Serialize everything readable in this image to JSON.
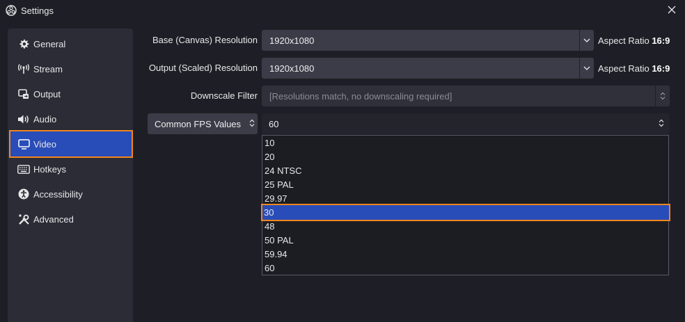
{
  "window": {
    "title": "Settings"
  },
  "sidebar": {
    "items": [
      {
        "label": "General",
        "icon": "gear-icon"
      },
      {
        "label": "Stream",
        "icon": "antenna-icon"
      },
      {
        "label": "Output",
        "icon": "output-icon"
      },
      {
        "label": "Audio",
        "icon": "speaker-icon"
      },
      {
        "label": "Video",
        "icon": "monitor-icon",
        "active": true
      },
      {
        "label": "Hotkeys",
        "icon": "keyboard-icon"
      },
      {
        "label": "Accessibility",
        "icon": "accessibility-icon"
      },
      {
        "label": "Advanced",
        "icon": "tools-icon"
      }
    ]
  },
  "video": {
    "base_resolution": {
      "label": "Base (Canvas) Resolution",
      "value": "1920x1080",
      "aspect_prefix": "Aspect Ratio",
      "aspect_value": "16:9"
    },
    "output_resolution": {
      "label": "Output (Scaled) Resolution",
      "value": "1920x1080",
      "aspect_prefix": "Aspect Ratio",
      "aspect_value": "16:9"
    },
    "downscale_filter": {
      "label": "Downscale Filter",
      "value": "[Resolutions match, no downscaling required]"
    },
    "fps_type": {
      "value": "Common FPS Values"
    },
    "fps_value": {
      "value": "60"
    },
    "fps_options": [
      "10",
      "20",
      "24 NTSC",
      "25 PAL",
      "29.97",
      "30",
      "48",
      "50 PAL",
      "59.94",
      "60"
    ],
    "highlighted_option": "30"
  },
  "colors": {
    "accent": "#284cb8",
    "highlight_outline": "#f0861f",
    "background": "#1e1f26",
    "panel": "#2b2c35"
  }
}
